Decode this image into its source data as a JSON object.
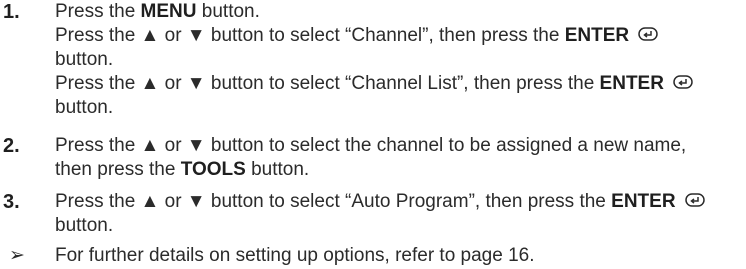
{
  "steps": [
    {
      "number": "1.",
      "lines": [
        {
          "pre": "Press the ",
          "bold": "MENU",
          "post": " button."
        },
        {
          "pre": "Press the ▲ or ▼ button to select “Channel”, then press the ",
          "bold": "ENTER",
          "post": ""
        },
        {
          "pre": "button.",
          "bold": "",
          "post": ""
        },
        {
          "pre": "Press the ▲ or ▼ button to select “Channel List”, then press the ",
          "bold": "ENTER",
          "post": ""
        },
        {
          "pre": "button.",
          "bold": "",
          "post": ""
        }
      ]
    },
    {
      "number": "2.",
      "lines": [
        {
          "pre": "Press the ▲ or ▼ button to select the channel to be assigned a new name,",
          "bold": "",
          "post": ""
        },
        {
          "pre": "then press the ",
          "bold": "TOOLS",
          "post": " button."
        }
      ]
    },
    {
      "number": "3.",
      "lines": [
        {
          "pre": "Press the ▲ or ▼ button to select “Auto Program”, then press the ",
          "bold": "ENTER",
          "post": ""
        },
        {
          "pre": "button.",
          "bold": "",
          "post": ""
        }
      ]
    }
  ],
  "note": {
    "arrow": "➢",
    "text": "For further details on setting up options, refer to page 16."
  },
  "icons": {
    "enter": "enter-icon"
  }
}
